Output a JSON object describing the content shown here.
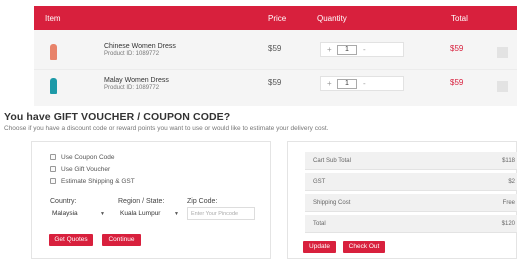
{
  "cart": {
    "headers": {
      "item": "Item",
      "price": "Price",
      "quantity": "Quantity",
      "total": "Total"
    },
    "items": [
      {
        "name": "Chinese Women Dress",
        "product_id": "Product ID: 1089772",
        "price": "$59",
        "qty": "1",
        "plus": "+",
        "minus": "-",
        "total": "$59"
      },
      {
        "name": "Malay Women Dress",
        "product_id": "Product ID: 1089772",
        "price": "$59",
        "qty": "1",
        "plus": "+",
        "minus": "-",
        "total": "$59"
      }
    ]
  },
  "voucher": {
    "heading": "You have GIFT VOUCHER / COUPON CODE?",
    "subtext": "Choose if you have a discount code or reward points you want to use or would like to estimate your delivery cost.",
    "options": [
      "Use Coupon Code",
      "Use Gift Voucher",
      "Estimate Shipping & GST"
    ],
    "country_label": "Country:",
    "region_label": "Region / State:",
    "zip_label": "Zip Code:",
    "country_value": "Malaysia",
    "region_value": "Kuala Lumpur",
    "zip_placeholder": "Enter Your Pincode",
    "get_quotes": "Get Quotes",
    "continue": "Continue"
  },
  "summary": {
    "rows": [
      {
        "label": "Cart Sub Total",
        "value": "$118"
      },
      {
        "label": "GST",
        "value": "$2"
      },
      {
        "label": "Shipping Cost",
        "value": "Free"
      },
      {
        "label": "Total",
        "value": "$120"
      }
    ],
    "update": "Update",
    "checkout": "Check Out"
  },
  "colors": {
    "accent": "#d8203d"
  }
}
